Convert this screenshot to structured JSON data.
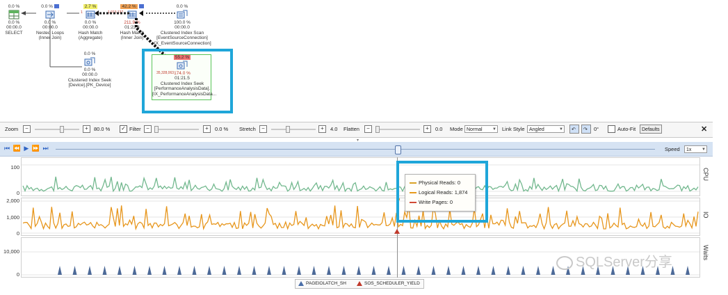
{
  "plan": {
    "select": {
      "pct": "0.0 %",
      "cost": "0.0 %",
      "time": "00:00.0",
      "name": "SELECT"
    },
    "nested_loops": {
      "pct": "0.0 %",
      "cost": "0.0 %",
      "time": "00:00.0",
      "name": "Nested Loops",
      "sub": "(Inner Join)"
    },
    "hash_match_agg": {
      "pct": "2.7 %",
      "rows": "1",
      "cost": "0.0 %",
      "time": "00:00.0",
      "name": "Hash Match",
      "sub": "(Aggregate)"
    },
    "hash_match_join": {
      "pct": "42.2 %",
      "rows": "1,013,137",
      "cost": "211.9 %",
      "time": "01:23.4",
      "name": "Hash Match",
      "sub": "(Inner Join)"
    },
    "ci_scan": {
      "pct": "0.0 %",
      "cost": "100.0 %",
      "time": "00:00.0",
      "name": "Clustered Index Scan",
      "obj": "[EventSourceConnection]",
      "idx": "[X_EventSourceConnection]"
    },
    "ci_seek_device": {
      "pct": "0.0 %",
      "cost": "0.0 %",
      "time": "00:00.0",
      "name": "Clustered Index Seek",
      "obj": "[Device].[PK_Device]"
    },
    "ci_seek_perf": {
      "pct": "55.2 %",
      "rows": "35,328,063",
      "cost": "174.0 %",
      "time": "01:21.5",
      "name": "Clustered Index Seek",
      "obj": "[PerformanceAnalysisData].",
      "idx": "[IX_PerformanceAnalysisData..."
    }
  },
  "toolbar": {
    "zoom_label": "Zoom",
    "zoom_value": "80.0 %",
    "filter_label": "Filter",
    "filter_checked": "✓",
    "filter_value": "0.0 %",
    "stretch_label": "Stretch",
    "stretch_value": "4.0",
    "flatten_label": "Flatten",
    "flatten_value": "0.0",
    "mode_label": "Mode",
    "mode_value": "Normal",
    "linkstyle_label": "Link Style",
    "linkstyle_value": "Angled",
    "rotate_value": "0°",
    "autofit_label": "Auto-Fit",
    "defaults_label": "Defaults",
    "close": "✕",
    "minus": "−",
    "plus": "+"
  },
  "playback": {
    "buttons": [
      "⏮",
      "⏪",
      "▶",
      "⏩",
      "⏭"
    ],
    "speed_label": "Speed",
    "speed_value": "1x"
  },
  "charts": {
    "cpu": {
      "label": "CPU",
      "ticks": [
        "100",
        "0"
      ]
    },
    "io": {
      "label": "IO",
      "ticks": [
        "2,000",
        "1,000",
        "0"
      ]
    },
    "waits": {
      "label": "Waits",
      "ticks": [
        "10,000",
        "0"
      ]
    }
  },
  "tooltip": {
    "rows": [
      {
        "text": "Physical Reads: 0",
        "color": "#d9a227"
      },
      {
        "text": "Logical Reads: 1,874",
        "color": "#e79a1c"
      },
      {
        "text": "Write Pages: 0",
        "color": "#d14a36"
      }
    ]
  },
  "legend": {
    "items": [
      {
        "text": "PAGEIOLATCH_SH",
        "color": "#4a6ea8"
      },
      {
        "text": "SOS_SCHEDULER_YIELD",
        "color": "#c0392b"
      }
    ]
  },
  "colors": {
    "cpu": "#72b88e",
    "io": "#e7961c",
    "waits": "#4d6a98",
    "highlight": "#1fa6d9"
  },
  "watermark": "SQLServer分享"
}
